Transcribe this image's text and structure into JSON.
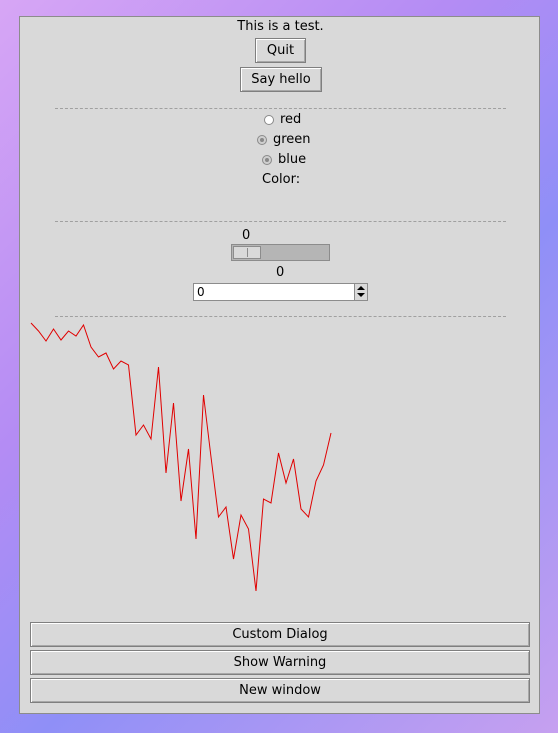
{
  "header": {
    "text": "This is a test."
  },
  "buttons": {
    "quit": "Quit",
    "say_hello": "Say hello"
  },
  "radios": [
    {
      "label": "red",
      "checked": false
    },
    {
      "label": "green",
      "checked": true
    },
    {
      "label": "blue",
      "checked": true
    }
  ],
  "color_label": "Color:",
  "scale": {
    "label_value": "0",
    "below_value": "0",
    "level": 0
  },
  "spinbox": {
    "value": "0"
  },
  "plot": {
    "color": "#e00000",
    "points_y": [
      2,
      10,
      20,
      8,
      19,
      10,
      15,
      4,
      26,
      36,
      32,
      48,
      40,
      44,
      114,
      104,
      118,
      46,
      152,
      82,
      180,
      128,
      218,
      74,
      136,
      196,
      186,
      238,
      194,
      208,
      270,
      178,
      182,
      132,
      162,
      138,
      188,
      196,
      160,
      144,
      112
    ]
  },
  "bottom_buttons": [
    "Custom Dialog",
    "Show Warning",
    "New window"
  ]
}
